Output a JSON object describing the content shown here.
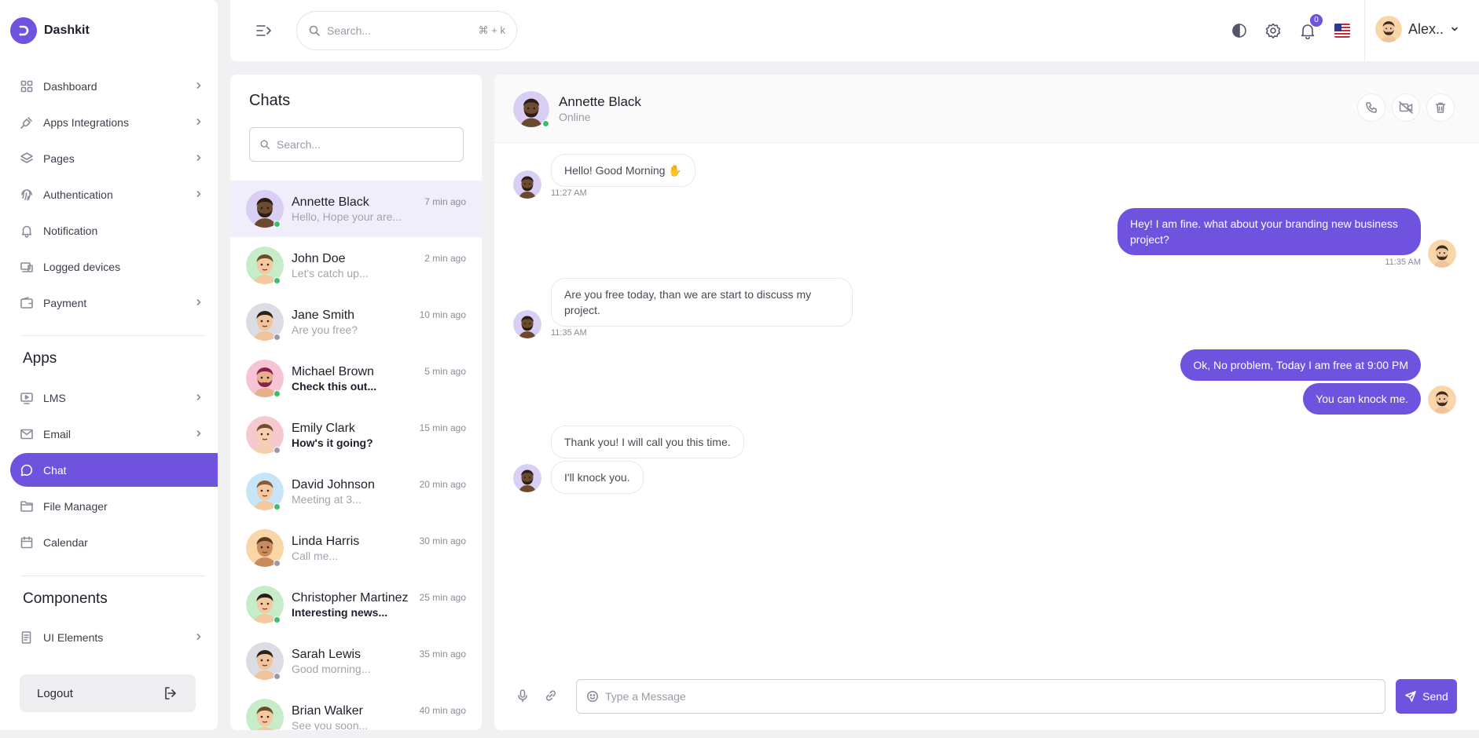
{
  "brand": {
    "name": "Dashkit"
  },
  "sidebar": {
    "items": [
      {
        "label": "Dashboard",
        "icon": "dashboard-grid-icon",
        "chevron": true
      },
      {
        "label": "Apps Integrations",
        "icon": "plug-icon",
        "chevron": true
      },
      {
        "label": "Pages",
        "icon": "layers-icon",
        "chevron": true
      },
      {
        "label": "Authentication",
        "icon": "fingerprint-icon",
        "chevron": true
      },
      {
        "label": "Notification",
        "icon": "bell-icon",
        "chevron": false
      },
      {
        "label": "Logged devices",
        "icon": "devices-icon",
        "chevron": false
      },
      {
        "label": "Payment",
        "icon": "wallet-icon",
        "chevron": true
      }
    ],
    "apps_section": "Apps",
    "apps": [
      {
        "label": "LMS",
        "icon": "monitor-play-icon",
        "chevron": true
      },
      {
        "label": "Email",
        "icon": "mail-icon",
        "chevron": true
      },
      {
        "label": "Chat",
        "icon": "chat-icon",
        "chevron": false,
        "active": true
      },
      {
        "label": "File Manager",
        "icon": "folder-icon",
        "chevron": false
      },
      {
        "label": "Calendar",
        "icon": "calendar-icon",
        "chevron": false
      }
    ],
    "components_section": "Components",
    "components": [
      {
        "label": "UI Elements",
        "icon": "document-icon",
        "chevron": true
      }
    ],
    "logout_label": "Logout"
  },
  "header": {
    "search_placeholder": "Search...",
    "search_shortcut": "⌘ + k",
    "notification_count": "0",
    "user_name": "Alex.."
  },
  "chats": {
    "title": "Chats",
    "search_placeholder": "Search...",
    "contacts": [
      {
        "name": "Annette Black",
        "message": "Hello, Hope your are...",
        "time": "7 min ago",
        "online": true,
        "unread": false,
        "active": true,
        "avatar_bg": "#d9cff5",
        "skin": "#6b4a2f",
        "hair": "#2a1d14"
      },
      {
        "name": "John Doe",
        "message": "Let's catch up...",
        "time": "2 min ago",
        "online": true,
        "unread": false,
        "avatar_bg": "#c7ecc9",
        "skin": "#f2c9a0",
        "hair": "#6b4b2a"
      },
      {
        "name": "Jane Smith",
        "message": "Are you free?",
        "time": "10 min ago",
        "online": false,
        "unread": false,
        "avatar_bg": "#dcdce2",
        "skin": "#f0c59d",
        "hair": "#2d2018"
      },
      {
        "name": "Michael Brown",
        "message": "Check this out...",
        "time": "5 min ago",
        "online": true,
        "unread": true,
        "avatar_bg": "#f7c4d4",
        "skin": "#e6b08a",
        "hair": "#8c1f4a"
      },
      {
        "name": "Emily Clark",
        "message": "How's it going?",
        "time": "15 min ago",
        "online": false,
        "unread": true,
        "avatar_bg": "#f6c9cf",
        "skin": "#f4cfb0",
        "hair": "#7a4a2c"
      },
      {
        "name": "David Johnson",
        "message": "Meeting at 3...",
        "time": "20 min ago",
        "online": true,
        "unread": false,
        "avatar_bg": "#c6e6f7",
        "skin": "#f2c9a0",
        "hair": "#8a5a32"
      },
      {
        "name": "Linda Harris",
        "message": "Call me...",
        "time": "30 min ago",
        "online": false,
        "unread": false,
        "avatar_bg": "#f9d6a8",
        "skin": "#c98b5c",
        "hair": "#5c3a1e"
      },
      {
        "name": "Christopher Martinez",
        "message": "Interesting news...",
        "time": "25 min ago",
        "online": true,
        "unread": true,
        "avatar_bg": "#c7ecc9",
        "skin": "#f2c9a0",
        "hair": "#2a1d14"
      },
      {
        "name": "Sarah Lewis",
        "message": "Good morning...",
        "time": "35 min ago",
        "online": false,
        "unread": false,
        "avatar_bg": "#dcdce2",
        "skin": "#f0c59d",
        "hair": "#2d2018"
      },
      {
        "name": "Brian Walker",
        "message": "See you soon...",
        "time": "40 min ago",
        "online": false,
        "unread": false,
        "avatar_bg": "#c7ecc9",
        "skin": "#f2c9a0",
        "hair": "#6b4b2a"
      }
    ]
  },
  "conversation": {
    "name": "Annette Black",
    "status": "Online",
    "messages": [
      {
        "from": "them",
        "text": "Hello! Good Morning ✋",
        "time": "11:27 AM"
      },
      {
        "from": "me",
        "text": "Hey! I am fine. what about your branding new business project?",
        "time": "11:35 AM"
      },
      {
        "from": "them",
        "text": "Are you free today, than we are start to discuss my project.",
        "time": "11:35 AM"
      },
      {
        "from": "me",
        "text": "Ok, No problem, Today I am free at 9:00 PM",
        "time": ""
      },
      {
        "from": "me",
        "text": "You can knock me.",
        "time": ""
      },
      {
        "from": "them",
        "text": "Thank you! I will call you this time.",
        "time": ""
      },
      {
        "from": "them",
        "text": "I'll knock you.",
        "time": ""
      }
    ],
    "input_placeholder": "Type a Message",
    "send_label": "Send"
  },
  "colors": {
    "accent": "#6f52de",
    "online": "#3bbf6a",
    "offline": "#9a9aa6"
  }
}
